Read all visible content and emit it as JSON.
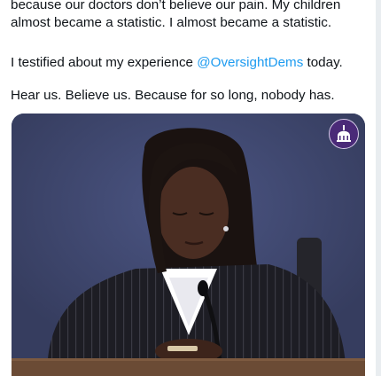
{
  "tweet": {
    "line1": "because our doctors don’t believe our pain. My children",
    "line2": "almost became a statistic. I almost became a statistic.",
    "line3_before": "I testified about my experience ",
    "mention": "@OversightDems",
    "line3_after": " today.",
    "line4": "Hear us. Believe us. Because for so long, nobody has."
  },
  "media": {
    "badge_icon": "capitol-dome-icon",
    "colors": {
      "backdrop": "#3f4870",
      "badge": "#4a2a78",
      "jacket": "#1c1c22",
      "desk": "#6b4b35"
    }
  }
}
